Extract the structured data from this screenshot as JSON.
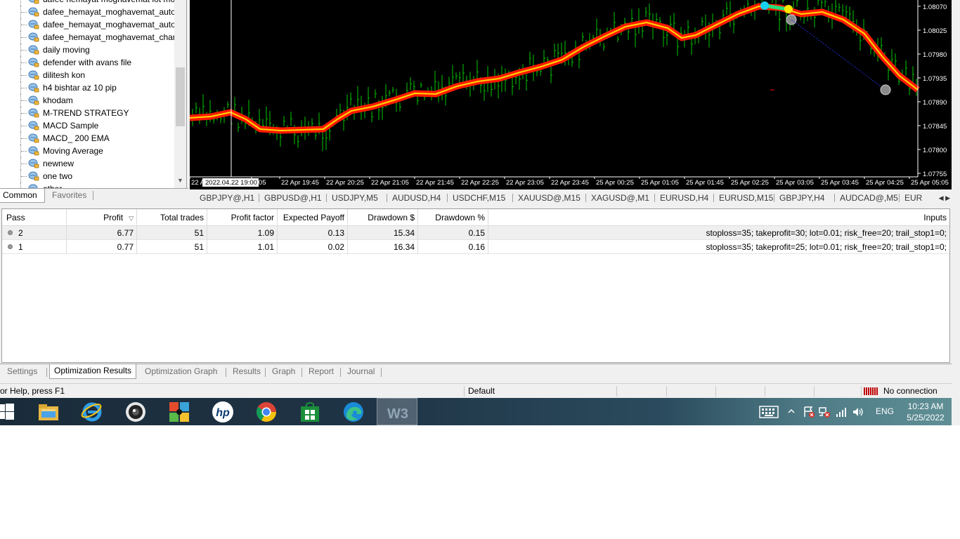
{
  "navigator": {
    "items": [
      {
        "label": "dafee hemayat moghavemat lot mo"
      },
      {
        "label": "dafee_hemayat_moghavemat_auto"
      },
      {
        "label": "dafee_hemayat_moghavemat_auto"
      },
      {
        "label": "dafee_hemayat_moghavemat_chan"
      },
      {
        "label": "daily moving"
      },
      {
        "label": "defender with avans file"
      },
      {
        "label": "dilitesh kon"
      },
      {
        "label": "h4 bishtar az 10 pip"
      },
      {
        "label": "khodam"
      },
      {
        "label": "M-TREND STRATEGY"
      },
      {
        "label": "MACD Sample"
      },
      {
        "label": "MACD_ 200 EMA"
      },
      {
        "label": "Moving Average"
      },
      {
        "label": "newnew"
      },
      {
        "label": "one two"
      },
      {
        "label": "other"
      }
    ],
    "tabs": {
      "common": "Common",
      "favorites": "Favorites"
    }
  },
  "chart": {
    "cursor_time": "2022.04.22 19:00",
    "price_labels": [
      "1.08070",
      "1.08025",
      "1.07980",
      "1.07935",
      "1.07890",
      "1.07845",
      "1.07800",
      "1.07755"
    ],
    "time_labels": [
      "22 A",
      "9:05",
      "22 Apr 19:45",
      "22 Apr 20:25",
      "22 Apr 21:05",
      "22 Apr 21:45",
      "22 Apr 22:25",
      "22 Apr 23:05",
      "22 Apr 23:45",
      "25 Apr 00:25",
      "25 Apr 01:05",
      "25 Apr 01:45",
      "25 Apr 02:25",
      "25 Apr 03:05",
      "25 Apr 03:45",
      "25 Apr 04:25",
      "25 Apr 05:05"
    ],
    "colors": {
      "background": "#000000",
      "bars": "#00c800",
      "ma_outer": "#ff1a00",
      "ma_inner": "#ffd700",
      "cursor": "#ffffff"
    }
  },
  "chart_tabs": [
    "GBPJPY@,H1",
    "GBPUSD@,H1",
    "USDJPY,M5",
    "AUDUSD,H4",
    "USDCHF,M15",
    "XAUUSD@,M15",
    "XAGUSD@,M1",
    "EURUSD,H4",
    "EURUSD,M15",
    "GBPJPY,H4",
    "AUDCAD@,M5",
    "EUR"
  ],
  "results": {
    "columns": {
      "pass": "Pass",
      "profit": "Profit",
      "total_trades": "Total trades",
      "profit_factor": "Profit factor",
      "expected_payoff": "Expected Payoff",
      "drawdown_usd": "Drawdown $",
      "drawdown_pct": "Drawdown %",
      "inputs": "Inputs"
    },
    "rows": [
      {
        "pass": "2",
        "profit": "6.77",
        "total_trades": "51",
        "profit_factor": "1.09",
        "expected_payoff": "0.13",
        "drawdown_usd": "15.34",
        "drawdown_pct": "0.15",
        "inputs": "stoploss=35; takeprofit=30; lot=0.01; risk_free=20; trail_stop1=0;"
      },
      {
        "pass": "1",
        "profit": "0.77",
        "total_trades": "51",
        "profit_factor": "1.01",
        "expected_payoff": "0.02",
        "drawdown_usd": "16.34",
        "drawdown_pct": "0.16",
        "inputs": "stoploss=35; takeprofit=25; lot=0.01; risk_free=20; trail_stop1=0;"
      }
    ]
  },
  "tester_tabs": {
    "settings": "Settings",
    "optimization_results": "Optimization Results",
    "optimization_graph": "Optimization Graph",
    "results": "Results",
    "graph": "Graph",
    "report": "Report",
    "journal": "Journal"
  },
  "statusbar": {
    "help": "or Help, press F1",
    "profile": "Default",
    "connection": "No connection"
  },
  "taskbar": {
    "apps": [
      "start-icon",
      "file-explorer-icon",
      "internet-explorer-icon",
      "webcam-icon",
      "puzzle-icon",
      "hp-icon",
      "chrome-icon",
      "store-icon",
      "edge-icon",
      "metatrader-icon"
    ],
    "lang": "ENG",
    "time": "10:23 AM",
    "date": "5/25/2022"
  }
}
